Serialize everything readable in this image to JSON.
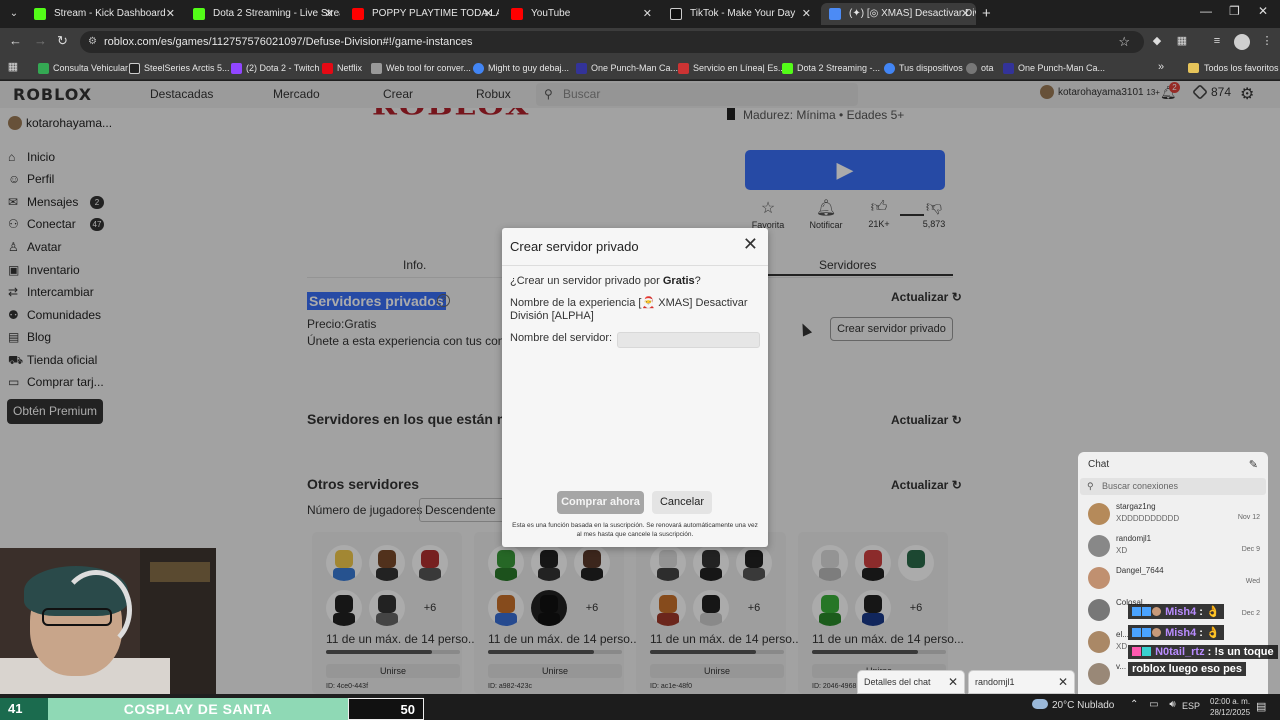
{
  "browser": {
    "tabs": [
      {
        "label": "Stream - Kick Dashboard",
        "color": "#53fc18"
      },
      {
        "label": "Dota 2 Streaming - Live Stream",
        "color": "#53fc18"
      },
      {
        "label": "POPPY PLAYTIME TODA LA HIS",
        "color": "#ff0000"
      },
      {
        "label": "YouTube",
        "color": "#ff0000"
      },
      {
        "label": "TikTok - Make Your Day",
        "color": "#111111"
      },
      {
        "label": "(✦) [◎ XMAS] Desactivar Divi",
        "color": "#4c8bf5"
      }
    ],
    "url": "roblox.com/es/games/112757576021097/Defuse-Division#!/game-instances",
    "bookmarks": [
      {
        "label": "Consulta Vehicular",
        "color": "#34a853"
      },
      {
        "label": "SteelSeries Arctis 5...",
        "color": "#222222"
      },
      {
        "label": "(2) Dota 2 - Twitch",
        "color": "#9146ff"
      },
      {
        "label": "Netflix",
        "color": "#e50914"
      },
      {
        "label": "Web tool for conver...",
        "color": "#999999"
      },
      {
        "label": "Might to guy debaj...",
        "color": "#4285f4"
      },
      {
        "label": "One Punch-Man Ca...",
        "color": "#333399"
      },
      {
        "label": "Servicio en Línea| Es...",
        "color": "#cc3333"
      },
      {
        "label": "Dota 2 Streaming -...",
        "color": "#53fc18"
      },
      {
        "label": "Tus dispositivos",
        "color": "#4285f4"
      },
      {
        "label": "ota",
        "color": "#777777"
      },
      {
        "label": "One Punch-Man Ca...",
        "color": "#333399"
      }
    ],
    "all_bookmarks": "Todos los favoritos"
  },
  "header": {
    "logo": "ROBLOX",
    "nav": [
      "Destacadas",
      "Mercado",
      "Crear",
      "Robux"
    ],
    "search_placeholder": "Buscar",
    "username": "kotarohayama3101",
    "age": "13+",
    "notif_count": "2",
    "robux": "874"
  },
  "sidebar": {
    "username": "kotarohayama...",
    "items": [
      {
        "label": "Inicio",
        "icon": "⌂"
      },
      {
        "label": "Perfil",
        "icon": "☺"
      },
      {
        "label": "Mensajes",
        "icon": "✉",
        "badge": "2"
      },
      {
        "label": "Conectar",
        "icon": "⚇",
        "badge": "47"
      },
      {
        "label": "Avatar",
        "icon": "♙"
      },
      {
        "label": "Inventario",
        "icon": "▣"
      },
      {
        "label": "Intercambiar",
        "icon": "⇄"
      },
      {
        "label": "Comunidades",
        "icon": "⚉"
      },
      {
        "label": "Blog",
        "icon": "▤"
      },
      {
        "label": "Tienda oficial",
        "icon": "⛟"
      },
      {
        "label": "Comprar tarj...",
        "icon": "▭"
      }
    ],
    "premium": "Obtén Premium"
  },
  "game": {
    "logo_text": "ROBLOX",
    "maturity": "Madurez: Mínima • Edades 5+",
    "favorite": "Favorita",
    "notify": "Notificar",
    "likes": "21K+",
    "dislikes": "5,873",
    "tabs": [
      "Info.",
      "Servidores"
    ],
    "private_title": "Servidores privados",
    "price_label": "Precio:",
    "price_value": "Gratis",
    "private_desc": "Únete a esta experiencia con tus conexio",
    "refresh": "Actualizar",
    "create_private": "Crear servidor privado",
    "friends_title": "Servidores en los que están mis",
    "others_title": "Otros servidores",
    "player_count_label": "Número de jugadores",
    "sort": "Descendente",
    "servers": [
      {
        "count": "11 de un máx. de 14 perso...",
        "fill": 0.79,
        "join": "Unirse",
        "id": "ID: 4ce0-443f",
        "more": "+6"
      },
      {
        "count": "11 de un máx. de 14 perso...",
        "fill": 0.79,
        "join": "Unirse",
        "id": "ID: a982-423c",
        "more": "+6"
      },
      {
        "count": "11 de un máx. de 14 perso...",
        "fill": 0.79,
        "join": "Unirse",
        "id": "ID: ac1e-48f0",
        "more": "+6"
      },
      {
        "count": "11 de un máx. de 14 perso...",
        "fill": 0.79,
        "join": "Unirse",
        "id": "ID: 2046-4968",
        "more": "+6"
      }
    ]
  },
  "modal": {
    "title": "Crear servidor privado",
    "question_prefix": "¿Crear un servidor privado por",
    "question_price": "Gratis",
    "question_suffix": "?",
    "experience_label": "Nombre de la experiencia",
    "experience_name": "[🎅 XMAS] Desactivar División [ALPHA]",
    "server_name_label": "Nombre del servidor:",
    "server_name_value": "",
    "buy": "Comprar ahora",
    "cancel": "Cancelar",
    "fine_print": "Esta es una función basada en la suscripción. Se renovará automáticamente una vez al mes hasta que cancele la suscripción."
  },
  "chat": {
    "title": "Chat",
    "search_placeholder": "Buscar conexiones",
    "conversations": [
      {
        "name": "stargaz1ng",
        "msg": "XDDDDDDDDDD",
        "date": "Nov 12",
        "color": "#b58a5a"
      },
      {
        "name": "randomjl1",
        "msg": "XD",
        "date": "Dec 9",
        "color": "#888888"
      },
      {
        "name": "Dangel_7644",
        "msg": "",
        "date": "Wed",
        "color": "#c09070"
      },
      {
        "name": "Colosal...",
        "msg": "",
        "date": "Dec 2",
        "color": "#777777"
      },
      {
        "name": "el...",
        "msg": "XD",
        "date": "",
        "color": "#aa8866"
      },
      {
        "name": "v...",
        "msg": "",
        "date": "",
        "color": "#998877"
      }
    ],
    "popups": [
      {
        "label": "Detalles del chat"
      },
      {
        "label": "randomjl1"
      }
    ]
  },
  "stream_overlay": {
    "left_num": "41",
    "title": "COSPLAY DE SANTA",
    "right_num": "50",
    "chat": [
      {
        "user": "Mish4",
        "msg": "👌"
      },
      {
        "user": "Mish4",
        "msg": "👌"
      },
      {
        "user": "N0tail_rtz",
        "msg": "!s un toque"
      },
      {
        "user": "",
        "msg": "roblox luego eso pes"
      }
    ]
  },
  "taskbar": {
    "weather": "20°C  Nublado",
    "lang": "ESP",
    "time": "02:00 a. m.",
    "date": "28/12/2025"
  }
}
